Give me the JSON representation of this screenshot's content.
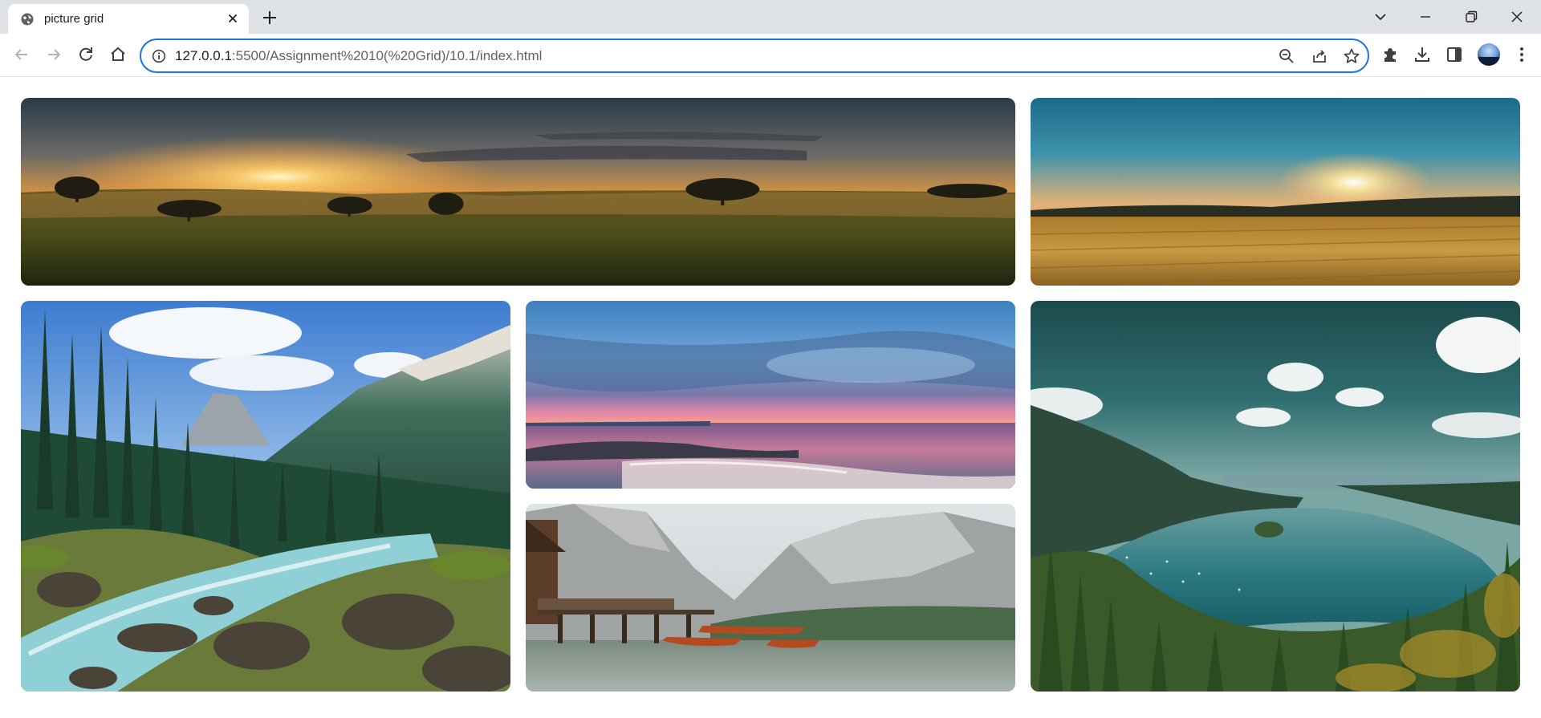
{
  "browser": {
    "tab_title": "picture grid",
    "url_host": "127.0.0.1",
    "url_path": ":5500/Assignment%2010(%20Grid)/10.1/index.html"
  },
  "icons": {
    "tab_favicon": "globe-icon",
    "tab_close": "close-icon",
    "new_tab": "plus-icon",
    "back": "arrow-left-icon",
    "forward": "arrow-right-icon",
    "reload": "reload-icon",
    "home": "home-icon",
    "site_info": "info-icon",
    "zoom": "zoom-out-icon",
    "share": "share-icon",
    "bookmark": "star-icon",
    "extensions": "puzzle-icon",
    "downloads": "download-icon",
    "side_panel": "side-panel-icon",
    "profile": "avatar",
    "tab_search": "chevron-down-icon",
    "minimize": "minimize-icon",
    "maximize": "restore-icon",
    "close_window": "close-icon"
  },
  "colors": {
    "accent": "#1a73e8",
    "tabstrip": "#dee1e6",
    "page_background": "#ffffff"
  },
  "grid": {
    "images": [
      {
        "subject": "sunrise over misty meadow with trees"
      },
      {
        "subject": "sunset over golden wheat field"
      },
      {
        "subject": "mountain river with rocks and pine forest"
      },
      {
        "subject": "pink sunset over ocean beach"
      },
      {
        "subject": "mountain lake with wooden dock and boats"
      },
      {
        "subject": "aerial view of forest lake with island"
      }
    ]
  }
}
